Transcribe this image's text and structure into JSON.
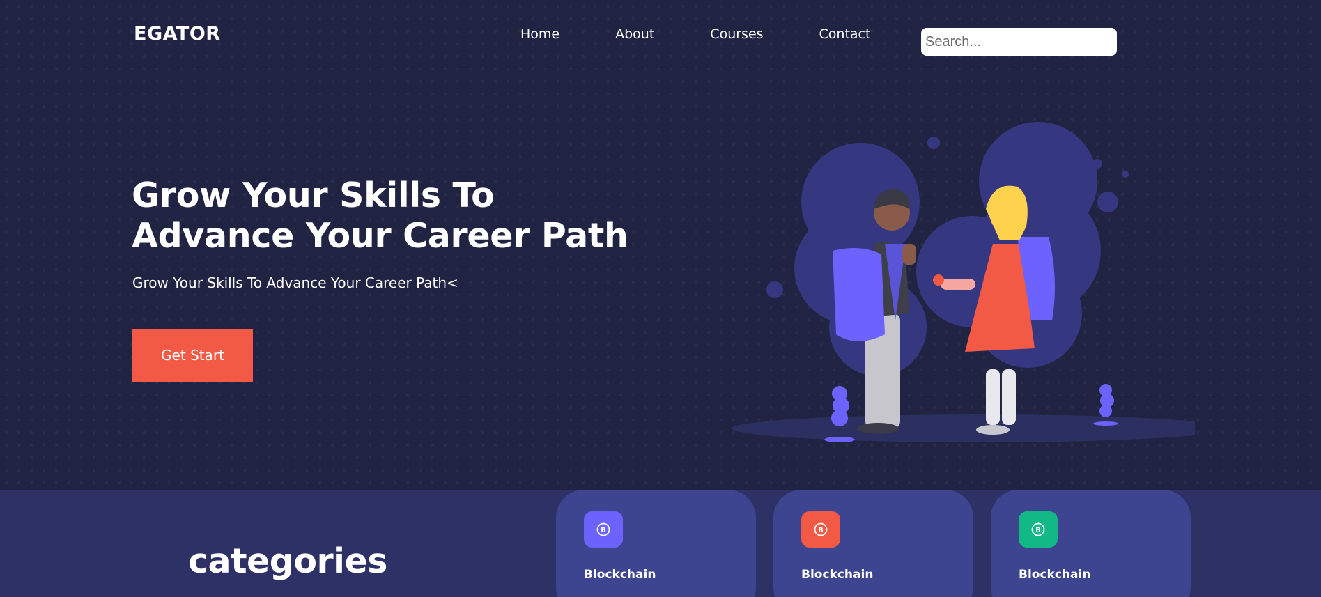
{
  "header": {
    "logo": "EGATOR",
    "nav": [
      "Home",
      "About",
      "Courses",
      "Contact"
    ],
    "search_placeholder": "Search..."
  },
  "hero": {
    "title_line1": "Grow Your Skills To",
    "title_line2": "Advance Your Career Path",
    "subtitle": "Grow Your Skills To Advance Your Career Path<",
    "cta_label": "Get Start",
    "illustration_icon": "students-illustration"
  },
  "categories": {
    "title": "categories",
    "cards": [
      {
        "label": "Blockchain",
        "icon": "bitcoin-icon",
        "color": "#6c63ff"
      },
      {
        "label": "Blockchain",
        "icon": "bitcoin-icon",
        "color": "#f25a45"
      },
      {
        "label": "Blockchain",
        "icon": "bitcoin-icon",
        "color": "#12b886"
      }
    ]
  },
  "colors": {
    "background": "#202442",
    "accent": "#f25a45",
    "section": "#2e3166",
    "card": "#3e4590"
  }
}
